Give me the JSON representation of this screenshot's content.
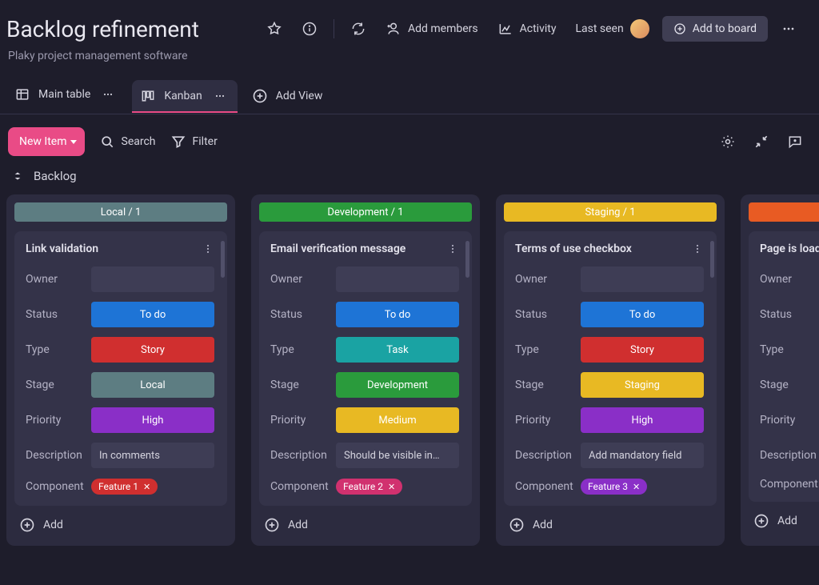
{
  "header": {
    "title": "Backlog refinement",
    "subtitle": "Plaky project management software",
    "add_members": "Add members",
    "activity": "Activity",
    "last_seen": "Last seen",
    "add_to_board": "Add to board"
  },
  "tabs": {
    "main_table": "Main table",
    "kanban": "Kanban",
    "add_view": "Add View"
  },
  "toolbar": {
    "new_item": "New Item",
    "search": "Search",
    "filter": "Filter"
  },
  "group": {
    "name": "Backlog"
  },
  "field_labels": {
    "owner": "Owner",
    "status": "Status",
    "type": "Type",
    "stage": "Stage",
    "priority": "Priority",
    "description": "Description",
    "component": "Component"
  },
  "columns": [
    {
      "header": "Local / 1",
      "header_bg": "#5d7d82",
      "card": {
        "title": "Link validation",
        "status": {
          "label": "To do",
          "bg": "#1e74d6"
        },
        "type": {
          "label": "Story",
          "bg": "#d02f2f"
        },
        "stage": {
          "label": "Local",
          "bg": "#5d7d82"
        },
        "priority": {
          "label": "High",
          "bg": "#8a2fc7"
        },
        "description": "In comments",
        "component": {
          "label": "Feature 1",
          "bg": "#d02f2f"
        }
      },
      "add": "Add"
    },
    {
      "header": "Development / 1",
      "header_bg": "#2a9b3c",
      "card": {
        "title": "Email verification message",
        "status": {
          "label": "To do",
          "bg": "#1e74d6"
        },
        "type": {
          "label": "Task",
          "bg": "#1aa3a3"
        },
        "stage": {
          "label": "Development",
          "bg": "#2a9b3c"
        },
        "priority": {
          "label": "Medium",
          "bg": "#e8b923"
        },
        "description": "Should be visible in…",
        "component": {
          "label": "Feature 2",
          "bg": "#d1316f"
        }
      },
      "add": "Add"
    },
    {
      "header": "Staging / 1",
      "header_bg": "#e8b923",
      "card": {
        "title": "Terms of use checkbox",
        "status": {
          "label": "To do",
          "bg": "#1e74d6"
        },
        "type": {
          "label": "Story",
          "bg": "#d02f2f"
        },
        "stage": {
          "label": "Staging",
          "bg": "#e8b923"
        },
        "priority": {
          "label": "High",
          "bg": "#8a2fc7"
        },
        "description": "Add mandatory field",
        "component": {
          "label": "Feature 3",
          "bg": "#8a2fc7"
        }
      },
      "add": "Add"
    },
    {
      "header": "",
      "header_bg": "#e85b23",
      "card": {
        "title": "Page is loadi",
        "status": {
          "label": "",
          "bg": ""
        },
        "type": {
          "label": "",
          "bg": ""
        },
        "stage": {
          "label": "",
          "bg": ""
        },
        "priority": {
          "label": "",
          "bg": ""
        },
        "description": "",
        "component": {
          "label": "",
          "bg": ""
        }
      },
      "add": "Add"
    }
  ]
}
